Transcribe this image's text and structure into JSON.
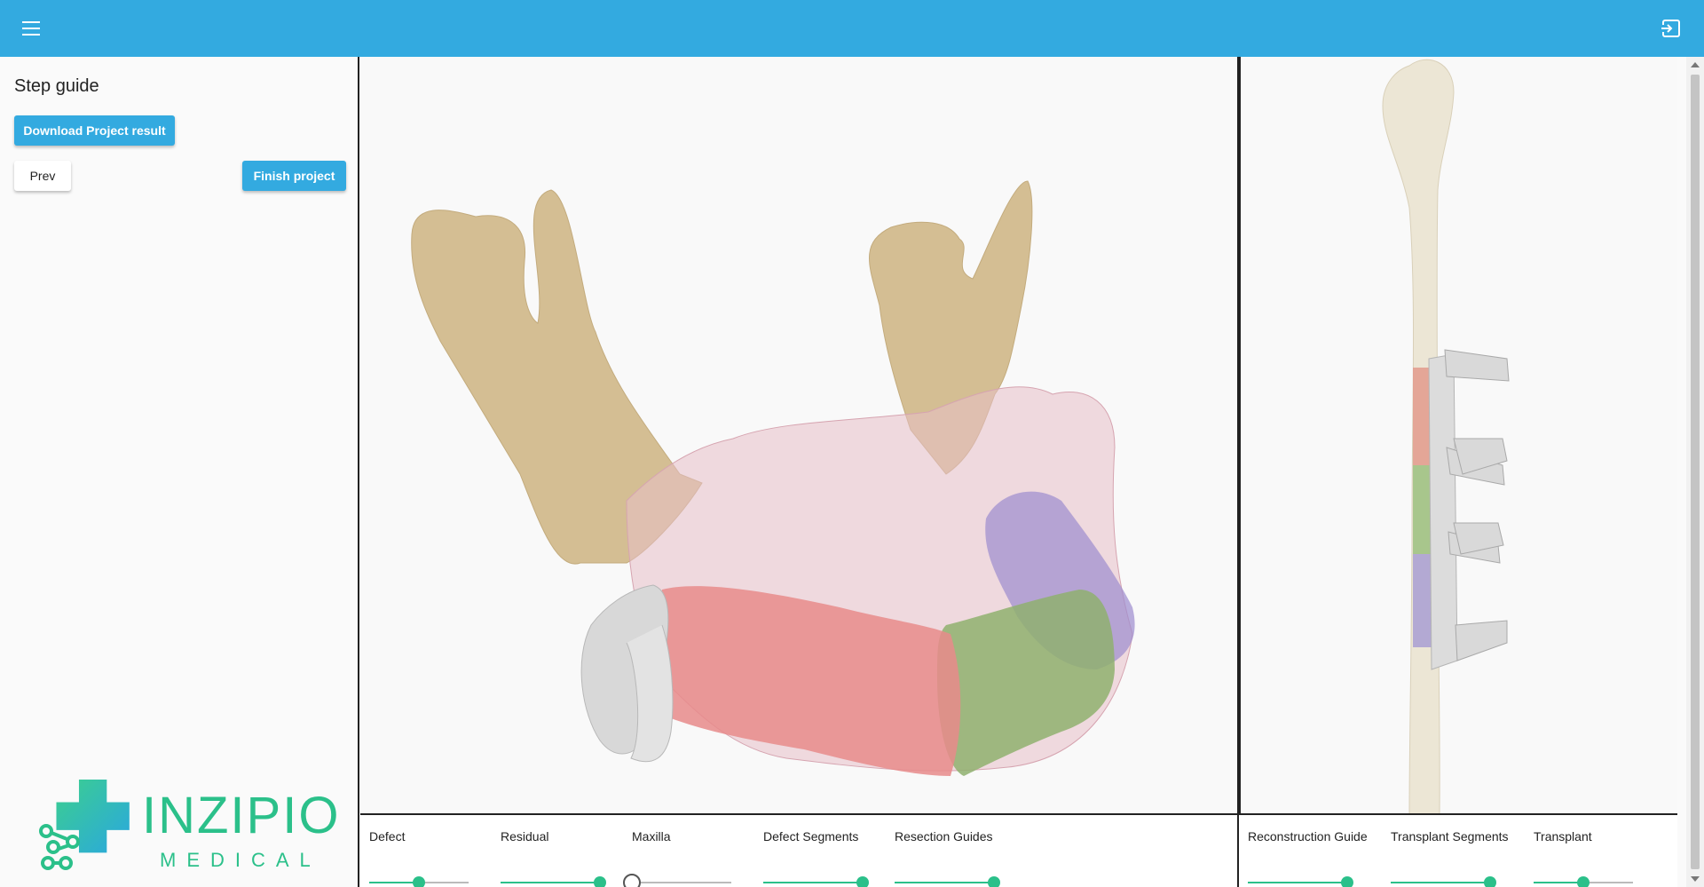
{
  "header": {
    "menu_icon": "hamburger-menu-icon",
    "logout_icon": "logout-icon",
    "accent_color": "#33aae0"
  },
  "sidebar": {
    "title": "Step guide",
    "download_button": "Download Project result",
    "prev_button": "Prev",
    "finish_button": "Finish project",
    "logo": {
      "name": "INZIPIO",
      "subtitle": "MEDICAL"
    }
  },
  "viewer_main": {
    "sliders": [
      {
        "label": "Defect",
        "value": 0.5
      },
      {
        "label": "Residual",
        "value": 1.0
      },
      {
        "label": "Maxilla",
        "value": 0.0
      },
      {
        "label": "Defect Segments",
        "value": 1.0
      },
      {
        "label": "Resection Guides",
        "value": 1.0
      }
    ]
  },
  "viewer_side": {
    "sliders": [
      {
        "label": "Reconstruction Guide",
        "value": 1.0
      },
      {
        "label": "Transplant Segments",
        "value": 1.0
      },
      {
        "label": "Transplant",
        "value": 0.5
      }
    ]
  },
  "colors": {
    "slider_active": "#2bc08a",
    "bone": "#d4be93",
    "defect_red": "#e78b8b",
    "segment_green": "#8fb06f",
    "segment_purple": "#9c8ccf",
    "soft_tissue": "#e7c0c8",
    "guide_gray": "#d8d8d8"
  }
}
